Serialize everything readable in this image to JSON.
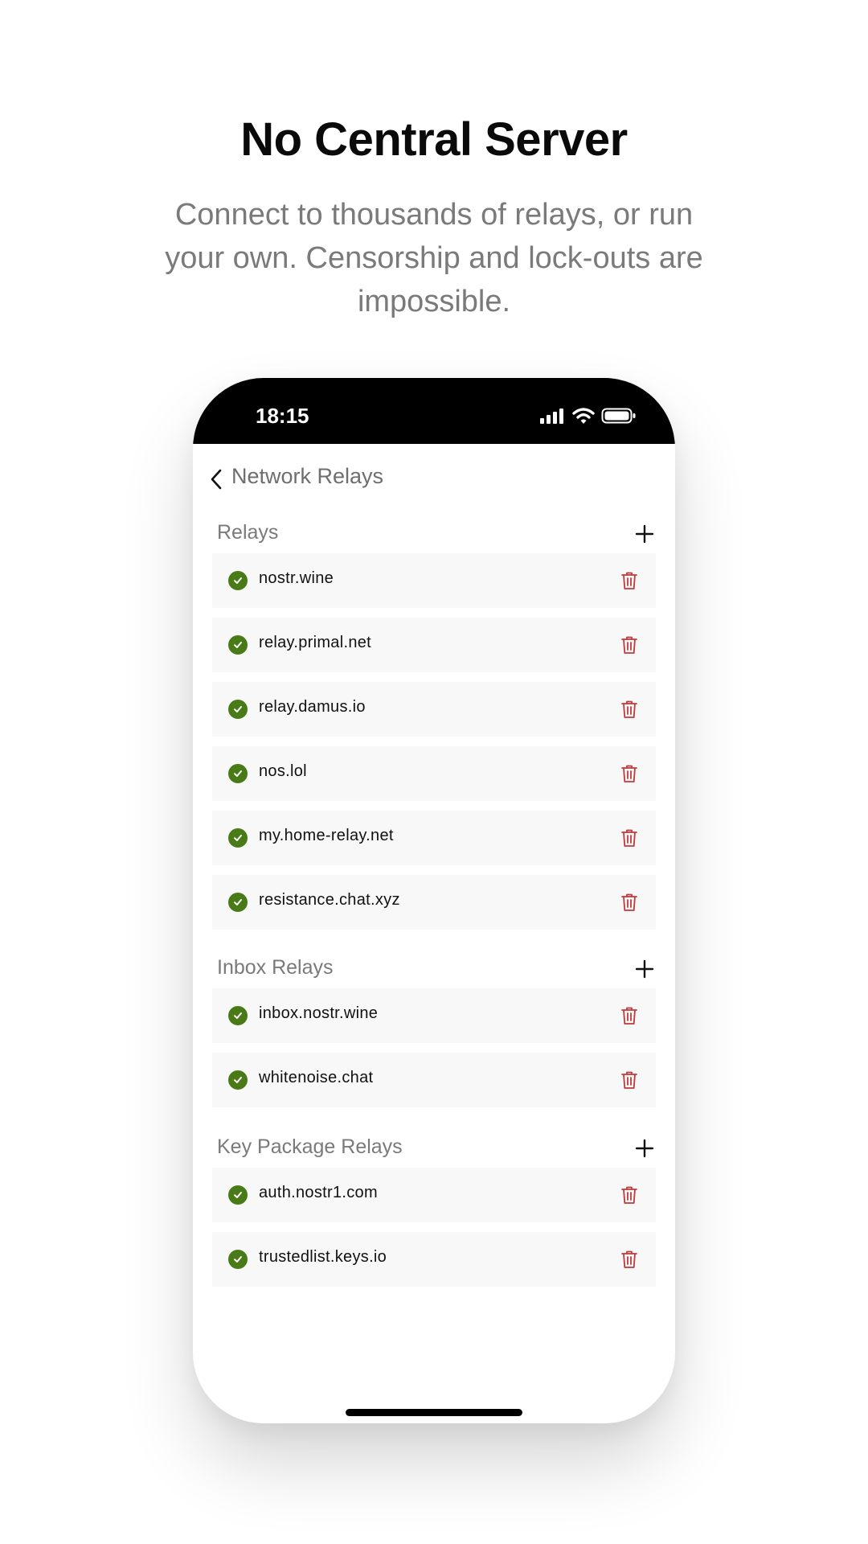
{
  "headline": "No Central Server",
  "subtitle": "Connect to thousands of relays, or run your own. Censorship and lock-outs are impossible.",
  "status_bar": {
    "time": "18:15",
    "icons": [
      "cellular-signal-icon",
      "wifi-icon",
      "battery-icon"
    ]
  },
  "screen": {
    "title": "Network Relays",
    "back_icon": "chevron-left-icon"
  },
  "sections": {
    "relays": {
      "label": "Relays",
      "items": [
        {
          "name": "nostr.wine",
          "status": "connected"
        },
        {
          "name": "relay.primal.net",
          "status": "connected"
        },
        {
          "name": "relay.damus.io",
          "status": "connected"
        },
        {
          "name": "nos.lol",
          "status": "connected"
        },
        {
          "name": "my.home-relay.net",
          "status": "connected"
        },
        {
          "name": "resistance.chat.xyz",
          "status": "connected"
        }
      ]
    },
    "inbox": {
      "label": "Inbox Relays",
      "items": [
        {
          "name": "inbox.nostr.wine",
          "status": "connected"
        },
        {
          "name": "whitenoise.chat",
          "status": "connected"
        }
      ]
    },
    "key_package": {
      "label": "Key Package Relays",
      "items": [
        {
          "name": "auth.nostr1.com",
          "status": "connected"
        },
        {
          "name": "trustedlist.keys.io",
          "status": "connected"
        }
      ]
    }
  },
  "colors": {
    "status_connected": "#4a7a17",
    "delete": "#c0393b",
    "item_background": "#f8f8f8",
    "headline": "#0a0a0a",
    "subtitle": "#7a7a7a"
  }
}
